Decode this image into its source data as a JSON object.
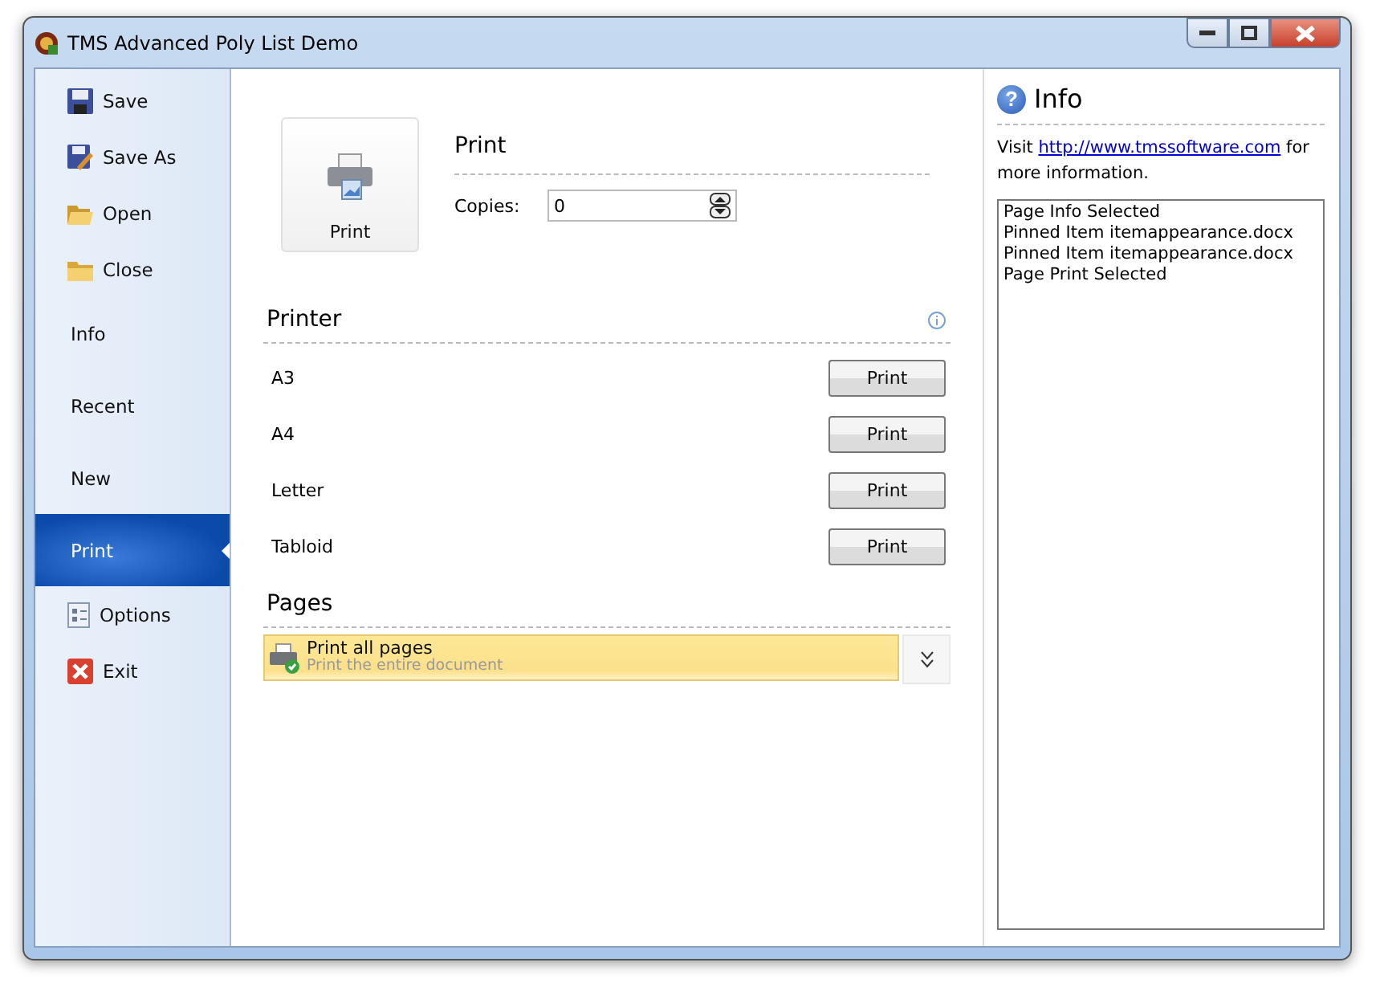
{
  "window": {
    "title": "TMS Advanced Poly List Demo"
  },
  "sidebar": {
    "items": [
      {
        "label": "Save",
        "kind": "command",
        "selected": false
      },
      {
        "label": "Save As",
        "kind": "command",
        "selected": false
      },
      {
        "label": "Open",
        "kind": "command",
        "selected": false
      },
      {
        "label": "Close",
        "kind": "command",
        "selected": false
      },
      {
        "label": "Info",
        "kind": "page",
        "selected": false
      },
      {
        "label": "Recent",
        "kind": "page",
        "selected": false
      },
      {
        "label": "New",
        "kind": "page",
        "selected": false
      },
      {
        "label": "Print",
        "kind": "page",
        "selected": true
      },
      {
        "label": "Options",
        "kind": "command",
        "selected": false
      },
      {
        "label": "Exit",
        "kind": "command",
        "selected": false
      }
    ]
  },
  "print": {
    "button": "Print",
    "heading": "Print",
    "copies_label": "Copies:",
    "copies_value": "0"
  },
  "printer": {
    "heading": "Printer",
    "rows": [
      {
        "name": "A3",
        "button": "Print"
      },
      {
        "name": "A4",
        "button": "Print"
      },
      {
        "name": "Letter",
        "button": "Print"
      },
      {
        "name": "Tabloid",
        "button": "Print"
      }
    ]
  },
  "pages": {
    "heading": "Pages",
    "option": {
      "title": "Print all pages",
      "description": "Print the entire document"
    }
  },
  "info": {
    "help_glyph": "?",
    "heading": "Info",
    "visit": "Visit",
    "link": "http://www.tmssoftware.com",
    "after": "for more information.",
    "log": [
      "Page Info Selected",
      "Pinned Item itemappearance.docx",
      "Pinned Item itemappearance.docx",
      "Page Print Selected"
    ]
  }
}
